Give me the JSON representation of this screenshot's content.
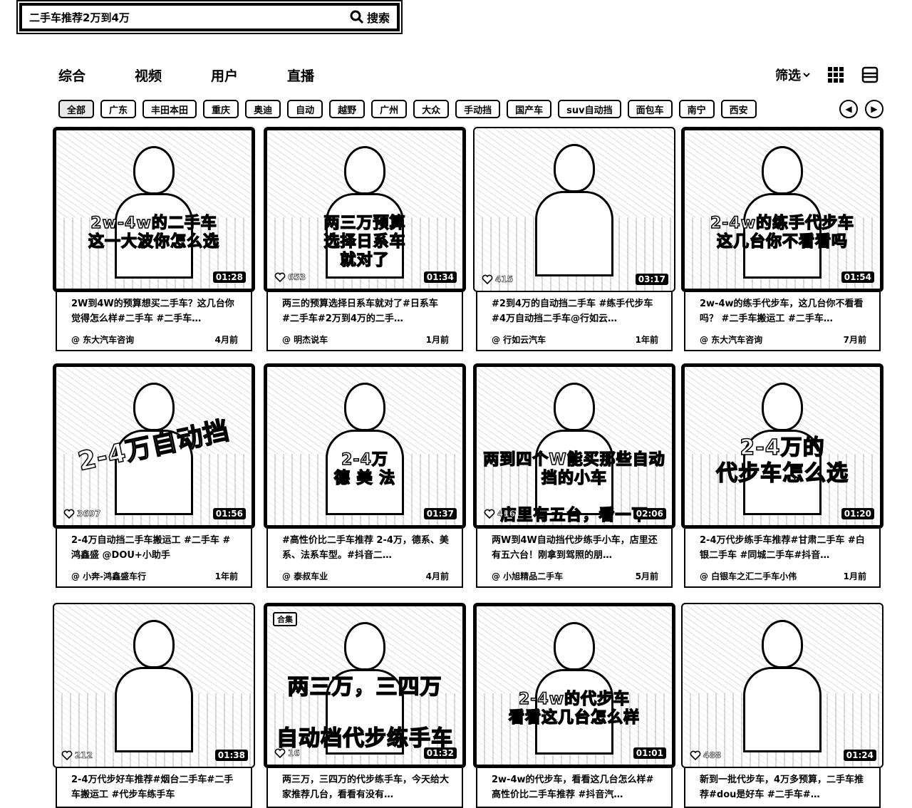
{
  "search": {
    "query": "二手车推荐2万到4万",
    "button_label": "搜索"
  },
  "tabs": [
    {
      "label": "综合",
      "active": true
    },
    {
      "label": "视频",
      "active": false
    },
    {
      "label": "用户",
      "active": false
    },
    {
      "label": "直播",
      "active": false
    }
  ],
  "toolbar": {
    "filter_label": "筛选",
    "grid_icon": "grid-icon",
    "list_icon": "list-icon"
  },
  "chips": [
    "全部",
    "广东",
    "丰田本田",
    "重庆",
    "奥迪",
    "自动",
    "越野",
    "广州",
    "大众",
    "手动挡",
    "国产车",
    "suv自动挡",
    "面包车",
    "南宁",
    "西安"
  ],
  "cards": [
    {
      "overlay": "2w-4w的二手车\n这一大波你怎么选",
      "duration": "01:28",
      "likes": "",
      "desc": "2W到4W的预算想买二手车？这几台你觉得怎么样#二手车 #二手车…",
      "author": "@ 东大汽车咨询",
      "time": "4月前",
      "badge": ""
    },
    {
      "overlay": "两三万预算\n选择日系车\n就对了",
      "duration": "01:34",
      "likes": "653",
      "desc": "两三的预算选择日系车就对了#日系车 #二手车#2万到4万的二手…",
      "author": "@ 明杰说车",
      "time": "1月前",
      "badge": ""
    },
    {
      "overlay": "",
      "duration": "03:17",
      "likes": "415",
      "desc": "#2到4万的自动挡二手车 #练手代步车 #4万自动挡二手车@行如云…",
      "author": "@ 行如云汽车",
      "time": "1年前",
      "badge": ""
    },
    {
      "overlay": "2-4w的练手代步车\n这几台你不看看吗",
      "duration": "01:54",
      "likes": "",
      "desc": "2w-4w的练手代步车，这几台你不看看吗？ #二手车搬运工 #二手车…",
      "author": "@ 东大汽车咨询",
      "time": "7月前",
      "badge": ""
    },
    {
      "overlay": "2-4万自动挡",
      "duration": "01:56",
      "likes": "3697",
      "desc": "2-4万自动挡二手车搬运工 #二手车 #鸿鑫盛 @DOU+小助手",
      "author": "@ 小奔-鸿鑫盛车行",
      "time": "1年前",
      "badge": ""
    },
    {
      "overlay": "2-4万\n德 美 法",
      "duration": "01:37",
      "likes": "",
      "desc": "#高性价比二手车推荐 2-4万，德系、美系、法系车型。#抖音二…",
      "author": "@ 泰叔车业",
      "time": "4月前",
      "badge": ""
    },
    {
      "overlay": "两到四个W能买那些自动挡的小车\n\n店里有五台，看一下",
      "duration": "02:06",
      "likes": "416",
      "desc": "两W到4W自动挡代步练手小车，店里还有五六台！刚拿到驾照的朋…",
      "author": "@ 小旭精品二手车",
      "time": "5月前",
      "badge": ""
    },
    {
      "overlay": "2-4万的\n代步车怎么选",
      "duration": "01:20",
      "likes": "",
      "desc": "2-4万代步练手车推荐#甘肃二手车 #白银二手车 #同城二手车#抖音…",
      "author": "@ 白银车之汇二手车小伟",
      "time": "1月前",
      "badge": ""
    },
    {
      "overlay": "",
      "duration": "01:38",
      "likes": "212",
      "desc": "2-4万代步好车推荐#烟台二手车#二手车搬运工 #代步车练手车",
      "author": "",
      "time": "",
      "badge": ""
    },
    {
      "overlay": "两三万，三四万\n\n自动档代步练手车",
      "duration": "01:32",
      "likes": "16",
      "desc": "两三万，三四万的代步练手车，今天给大家推荐几台，看看有没有…",
      "author": "",
      "time": "",
      "badge": "合集"
    },
    {
      "overlay": "2-4w的代步车\n看看这几台怎么样",
      "duration": "01:01",
      "likes": "",
      "desc": "2w-4w的代步车，看看这几台怎么样#高性价比二手车推荐 #抖音汽…",
      "author": "",
      "time": "",
      "badge": ""
    },
    {
      "overlay": "",
      "duration": "01:24",
      "likes": "488",
      "desc": "新到一批代步车，4万多预算，二手车推荐#dou是好车 #二手车#…",
      "author": "",
      "time": "",
      "badge": ""
    }
  ]
}
